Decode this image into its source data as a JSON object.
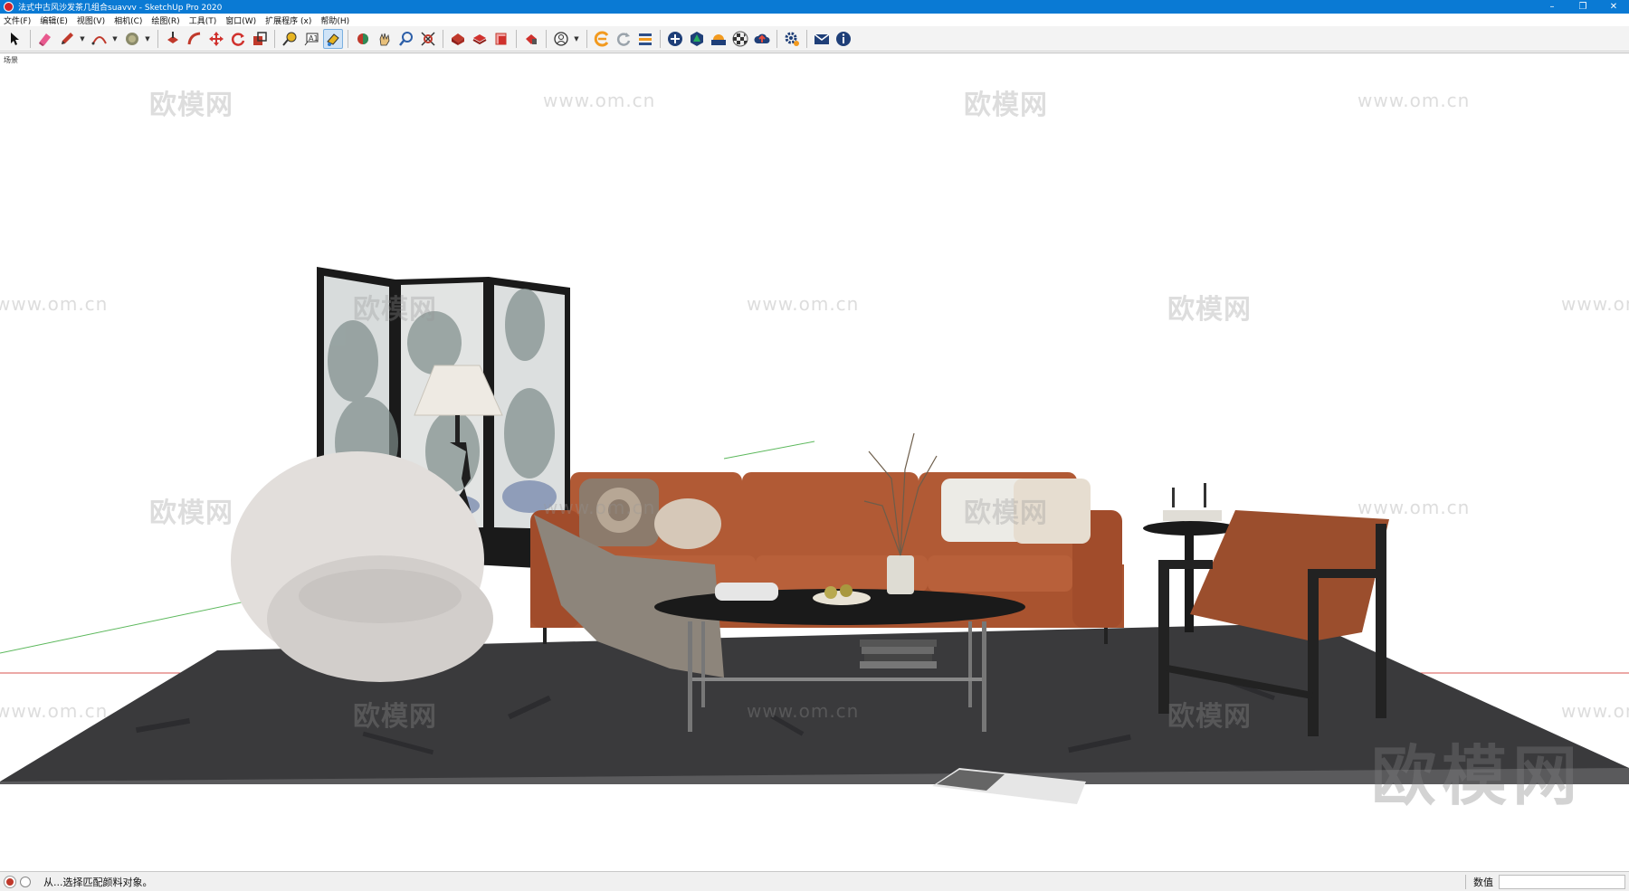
{
  "window": {
    "title": "法式中古风沙发茶几组合suavvv - SketchUp Pro 2020",
    "controls": [
      "–",
      "❐",
      "✕"
    ]
  },
  "menu": [
    "文件(F)",
    "编辑(E)",
    "视图(V)",
    "相机(C)",
    "绘图(R)",
    "工具(T)",
    "窗口(W)",
    "扩展程序 (x)",
    "帮助(H)"
  ],
  "toolbar": {
    "groups": [
      [
        "select-tool-icon"
      ],
      [
        "eraser-icon",
        "pencil-icon",
        "arc-icon",
        "paint-bucket-icon"
      ],
      [
        "push-pull-icon",
        "follow-me-icon",
        "move-icon",
        "rotate-icon",
        "scale-icon"
      ],
      [
        "tape-measure-icon",
        "text-icon",
        "paint-icon"
      ],
      [
        "orbit-icon",
        "pan-icon",
        "zoom-icon",
        "zoom-extents-icon"
      ],
      [
        "warehouse-icon",
        "components-icon",
        "send-to-layout-icon"
      ],
      [
        "extension-warehouse-icon"
      ],
      [
        "account-icon"
      ],
      [
        "plugin-e-icon",
        "refresh-icon",
        "layers-icon"
      ],
      [
        "add-icon",
        "tree-icon",
        "sun-icon",
        "checker-icon",
        "cloud-upload-icon"
      ],
      [
        "settings-icon"
      ],
      [
        "mail-icon",
        "info-icon"
      ]
    ]
  },
  "viewport": {
    "scene_tab": "场景",
    "watermarks": {
      "logo_text": "欧模网",
      "url_text": "www.om.cn",
      "corner_logo": "欧模网"
    }
  },
  "status": {
    "text": "从...选择匹配颜料对象。",
    "measurements_label": "数值",
    "measurements_value": ""
  }
}
